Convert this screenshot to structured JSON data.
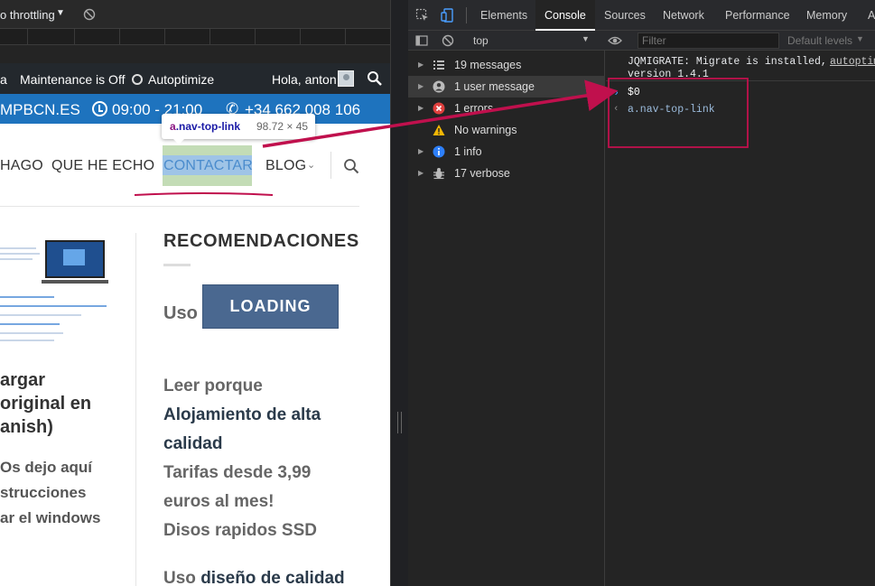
{
  "preview": {
    "toolbar": {
      "throttle": "o throttling",
      "caret": "▼",
      "kebab": "⋮"
    },
    "adminbar": {
      "first": "a",
      "maintenance": "Maintenance is Off",
      "autoptimize": "Autoptimize",
      "greeting": "Hola, anton"
    },
    "bluebar": {
      "site": "MPBCN.ES",
      "hours": "09:00 - 21:00",
      "phone_icon": "✆",
      "phone": "+34 662 008 106"
    },
    "tooltip": {
      "tag": "a",
      "cls": ".nav-top-link",
      "dims": "98.72 × 45"
    },
    "nav": {
      "items": [
        "HAGO",
        "QUE HE ECHO",
        "CONTACTAR",
        "BLOG"
      ],
      "chevron": "⌄"
    },
    "article": {
      "title_lines": [
        "argar",
        " original en",
        "anish)"
      ],
      "desc_lines": [
        "Os dejo aquí",
        "strucciones",
        "ar el windows"
      ]
    },
    "sidebar": {
      "heading": "RECOMENDACIONES",
      "uso": "Uso",
      "loading": "LOADING",
      "lines": [
        {
          "text": "Leer porque",
          "style": "g"
        },
        {
          "text": "Alojamiento de alta",
          "style": "dk"
        },
        {
          "text": "calidad",
          "style": "dk"
        },
        {
          "text": "Tarifas desde 3,99",
          "style": "g"
        },
        {
          "text": "euros al mes!",
          "style": "g"
        },
        {
          "text": "Disos rapidos SSD",
          "style": "g"
        }
      ],
      "uso2_a": "Uso ",
      "uso2_b": "diseño de calidad"
    }
  },
  "devtools": {
    "tabs": [
      "Elements",
      "Console",
      "Sources",
      "Network",
      "Performance",
      "Memory",
      "A"
    ],
    "active_tab": "Console",
    "context": "top",
    "context_caret": "▼",
    "filter_placeholder": "Filter",
    "levels": "Default levels",
    "levels_caret": "▼",
    "sidebar": [
      {
        "label": "19 messages",
        "icon": "list-icon",
        "selected": false
      },
      {
        "label": "1 user message",
        "icon": "user-icon",
        "selected": true
      },
      {
        "label": "1 errors",
        "icon": "error-icon",
        "selected": false
      },
      {
        "label": "No warnings",
        "icon": "warning-icon",
        "selected": false
      },
      {
        "label": "1 info",
        "icon": "info-icon",
        "selected": false
      },
      {
        "label": "17 verbose",
        "icon": "bug-icon",
        "selected": false
      }
    ],
    "console": {
      "line1": "JQMIGRATE: Migrate is installed,",
      "line1_link": "autoptim",
      "line2": "version 1.4.1",
      "input_prompt": "›",
      "input": "$0",
      "output_prompt": "‹",
      "output": "a.nav-top-link"
    }
  },
  "colors": {
    "annotation": "#c0104d",
    "highlight_padding": "#c3dcb6",
    "highlight_content": "#9fc4e7",
    "bluebar": "#1e73be"
  }
}
